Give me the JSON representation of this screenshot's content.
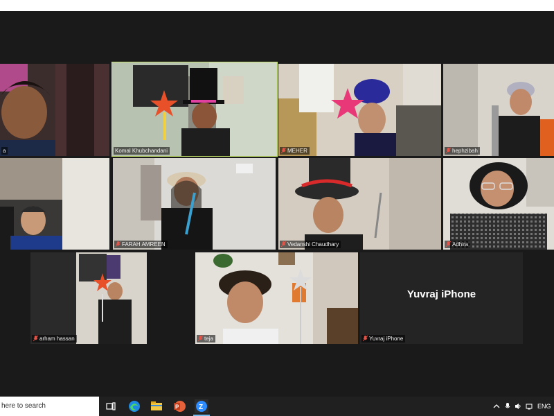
{
  "meeting": {
    "participants": [
      {
        "name": "a"
      },
      {
        "name": "Komal Khubchandani"
      },
      {
        "name": "MEHER"
      },
      {
        "name": "hephzibah"
      },
      {
        "name": ""
      },
      {
        "name": "FARAH AMREEN"
      },
      {
        "name": "Vedanshi Chaudhary"
      },
      {
        "name": "Adhira"
      },
      {
        "name": "arham hassan"
      },
      {
        "name": "teja"
      },
      {
        "name": "Yuvraj iPhone",
        "display_name": "Yuvraj iPhone"
      }
    ],
    "active_speaker_color": "#c5e26b",
    "muted_icon_color": "#e0554a"
  },
  "taskbar": {
    "search_text": "here to search",
    "apps": [
      "task-view",
      "edge",
      "file-explorer",
      "powerpoint",
      "zoom"
    ],
    "tray": {
      "language": "ENG"
    }
  }
}
